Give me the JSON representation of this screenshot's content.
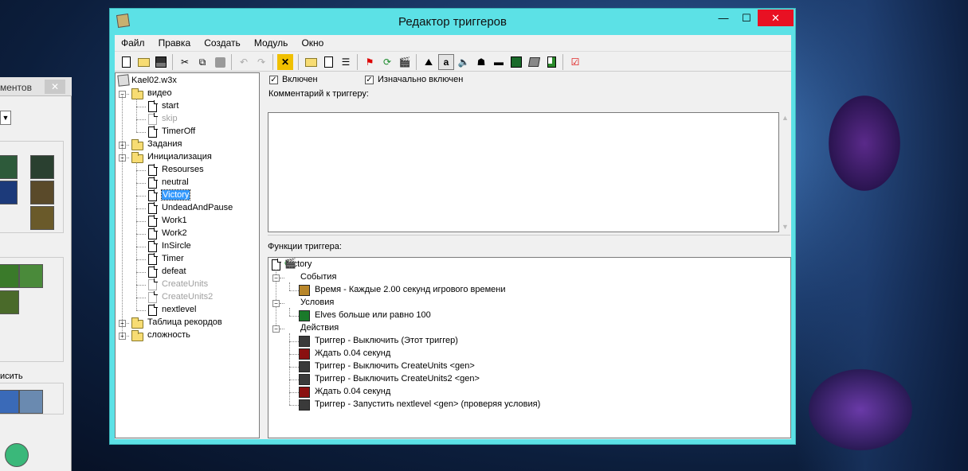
{
  "palette": {
    "title": "ментов",
    "close": "✕",
    "label": "исить"
  },
  "window": {
    "title": "Редактор триггеров",
    "controls": {
      "minimize": "—",
      "maximize": "☐",
      "close": "✕"
    }
  },
  "menu": [
    "Файл",
    "Правка",
    "Создать",
    "Модуль",
    "Окно"
  ],
  "toolbar": [
    "new-trigger",
    "open",
    "save",
    "cut",
    "copy",
    "paste",
    "undo",
    "redo",
    "delete",
    "new-category",
    "new-trigger-doc",
    "new-comment",
    "new-event",
    "new-condition",
    "new-action",
    "terrain",
    "units",
    "sound",
    "ai",
    "camera",
    "regions",
    "objects",
    "import",
    "test-map"
  ],
  "tree": {
    "root": "Kael02.w3x",
    "nodes": [
      {
        "label": "видео",
        "type": "folder",
        "expanded": true
      },
      {
        "label": "start",
        "type": "trigger"
      },
      {
        "label": "skip",
        "type": "trigger",
        "disabled": true
      },
      {
        "label": "TimerOff",
        "type": "trigger"
      },
      {
        "label": "Задания",
        "type": "folder",
        "expanded": false
      },
      {
        "label": "Инициализация",
        "type": "folder",
        "expanded": true
      },
      {
        "label": "Resourses",
        "type": "trigger"
      },
      {
        "label": "neutral",
        "type": "trigger"
      },
      {
        "label": "Victory",
        "type": "trigger",
        "selected": true
      },
      {
        "label": "UndeadAndPause",
        "type": "trigger"
      },
      {
        "label": "Work1",
        "type": "trigger"
      },
      {
        "label": "Work2",
        "type": "trigger"
      },
      {
        "label": "InSircle",
        "type": "trigger"
      },
      {
        "label": "Timer",
        "type": "trigger"
      },
      {
        "label": "defeat",
        "type": "trigger"
      },
      {
        "label": "CreateUnits",
        "type": "trigger",
        "disabled": true
      },
      {
        "label": "CreateUnits2",
        "type": "trigger",
        "disabled": true
      },
      {
        "label": "nextlevel",
        "type": "trigger"
      },
      {
        "label": "Таблица рекордов",
        "type": "folder",
        "expanded": false
      },
      {
        "label": "сложность",
        "type": "folder",
        "expanded": false
      }
    ]
  },
  "editor": {
    "enabled_label": "Включен",
    "initially_on_label": "Изначально включен",
    "enabled": true,
    "initially_on": true,
    "comment_label": "Комментарий к триггеру:",
    "comment_value": "",
    "functions_label": "Функции триггера:",
    "trigger_name": "Victory",
    "events_label": "События",
    "conditions_label": "Условия",
    "actions_label": "Действия",
    "events": [
      "Время - Каждые 2.00 секунд игрового времени"
    ],
    "conditions": [
      "Elves больше или равно 100"
    ],
    "actions": [
      "Триггер - Выключить (Этот триггер)",
      "Ждать 0.04 секунд",
      "Триггер - Выключить CreateUnits <gen>",
      "Триггер - Выключить CreateUnits2 <gen>",
      "Ждать 0.04 секунд",
      "Триггер - Запустить nextlevel <gen> (проверяя условия)"
    ]
  },
  "colors": {
    "window_frame": "#5ce1e6",
    "selection": "#3399ff",
    "close_button": "#e81123"
  }
}
